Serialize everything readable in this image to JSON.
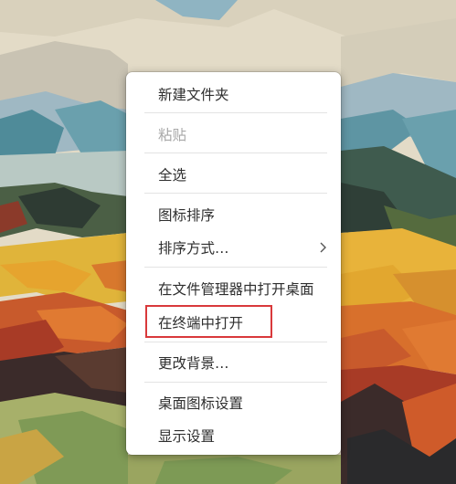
{
  "colors": {
    "menu_background": "#ffffff",
    "menu_text": "#2e2e2e",
    "disabled_text": "#a8a8a8",
    "separator": "#e3e3e3",
    "highlight_border": "#d9393b"
  },
  "context_menu": {
    "new_folder": "新建文件夹",
    "paste": "粘贴",
    "select_all": "全选",
    "arrange_icons": "图标排序",
    "sort_by": "排序方式…",
    "open_desktop_in_file_manager": "在文件管理器中打开桌面",
    "open_in_terminal": "在终端中打开",
    "change_background": "更改背景…",
    "desktop_icon_settings": "桌面图标设置",
    "display_settings": "显示设置"
  },
  "icons": {
    "submenu_arrow": "chevron-right-icon"
  }
}
